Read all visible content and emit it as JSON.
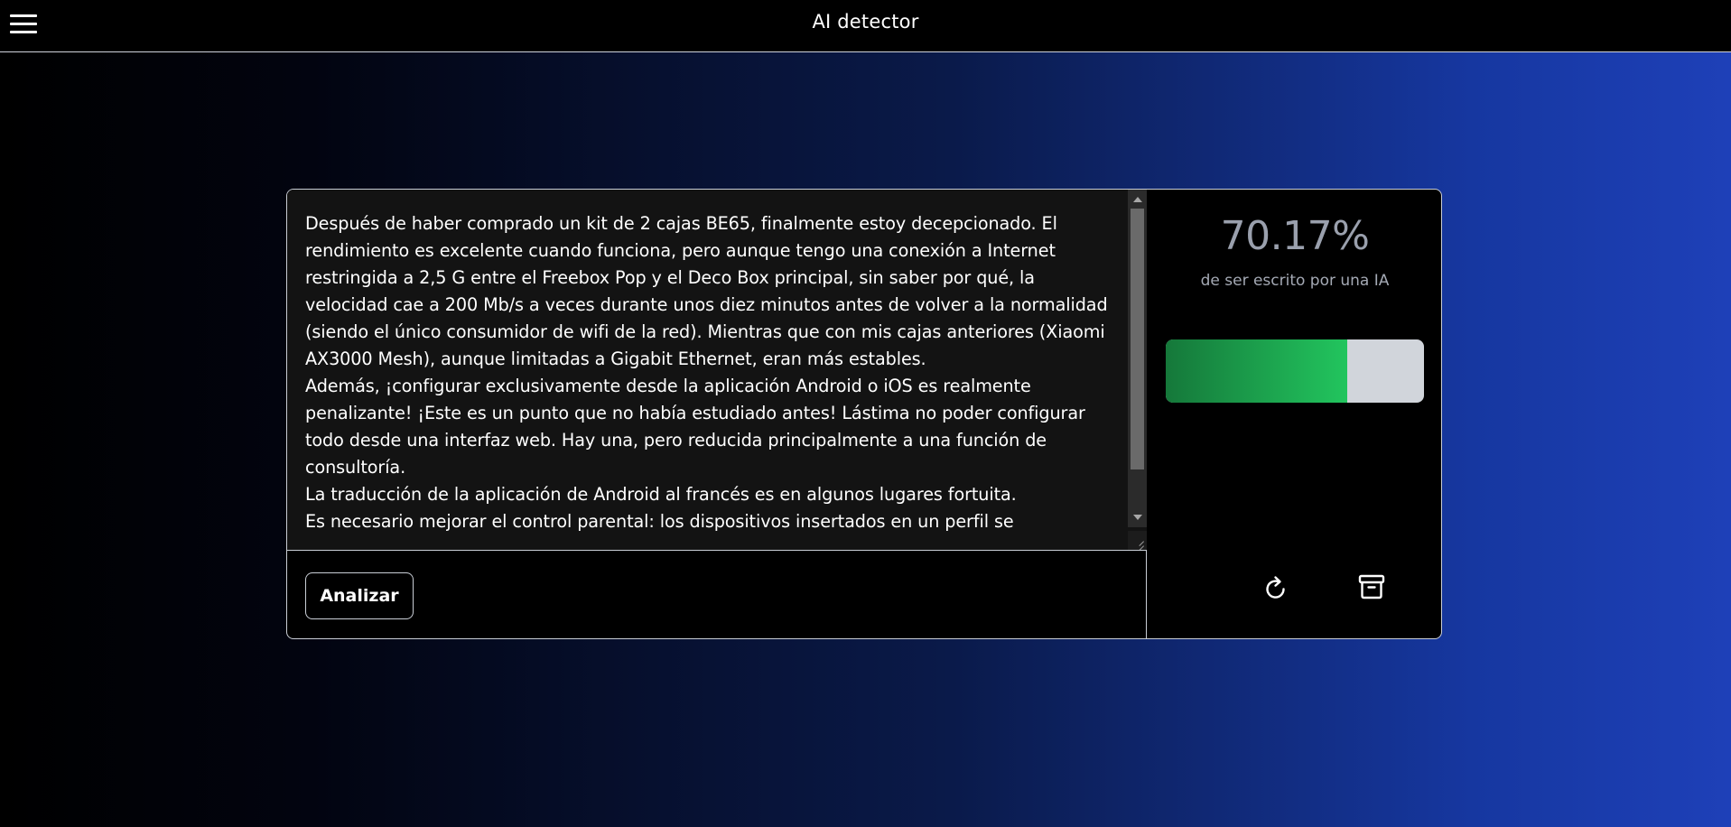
{
  "header": {
    "title": "AI detector",
    "menu_icon": "hamburger-menu-icon"
  },
  "editor": {
    "text": "Después de haber comprado un kit de 2 cajas BE65, finalmente estoy decepcionado. El rendimiento es excelente cuando funciona, pero aunque tengo una conexión a Internet restringida a 2,5 G entre el Freebox Pop y el Deco Box principal, sin saber por qué, la velocidad cae a 200 Mb/s a veces durante unos diez minutos antes de volver a la normalidad (siendo el único consumidor de wifi de la red). Mientras que con mis cajas anteriores (Xiaomi AX3000 Mesh), aunque limitadas a Gigabit Ethernet, eran más estables.\nAdemás, ¡configurar exclusivamente desde la aplicación Android o iOS es realmente penalizante! ¡Este es un punto que no había estudiado antes! Lástima no poder configurar todo desde una interfaz web. Hay una, pero reducida principalmente a una función de consultoría.\nLa traducción de la aplicación de Android al francés es en algunos lugares fortuita.\nEs necesario mejorar el control parental: los dispositivos insertados en un perfil se",
    "analyze_label": "Analizar"
  },
  "result": {
    "percent_text": "70.17%",
    "label": "de ser escrito por una IA",
    "ai_probability": 0.7017,
    "colors": {
      "meter_fill_start": "#15783a",
      "meter_fill_end": "#22c55e",
      "meter_track": "#d1d5db"
    }
  },
  "actions": {
    "refresh_icon": "refresh-icon",
    "archive_icon": "archive-icon"
  }
}
